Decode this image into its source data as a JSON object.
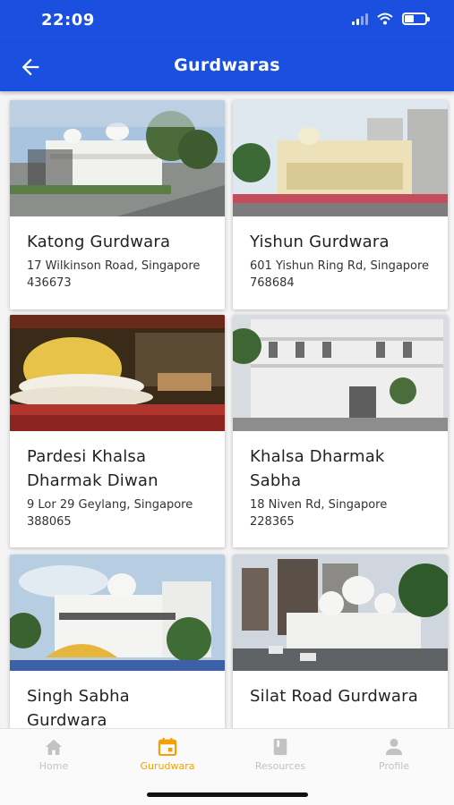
{
  "status_bar": {
    "time": "22:09"
  },
  "app_bar": {
    "title": "Gurdwaras"
  },
  "gurdwaras": [
    {
      "name": "Katong Gurdwara",
      "address": "17 Wilkinson Road, Singapore 436673"
    },
    {
      "name": "Yishun Gurdwara",
      "address": "601 Yishun Ring Rd, Singapore 768684"
    },
    {
      "name": "Pardesi Khalsa Dharmak Diwan",
      "address": "9 Lor 29 Geylang, Singapore 388065"
    },
    {
      "name": "Khalsa Dharmak Sabha",
      "address": "18 Niven Rd, Singapore 228365"
    },
    {
      "name": "Singh Sabha Gurdwara",
      "address": ""
    },
    {
      "name": "Silat Road Gurdwara",
      "address": ""
    }
  ],
  "bottom_nav": {
    "items": [
      {
        "label": "Home",
        "icon": "home-icon"
      },
      {
        "label": "Gurudwara",
        "icon": "calendar-icon",
        "active": true
      },
      {
        "label": "Resources",
        "icon": "book-icon"
      },
      {
        "label": "Profile",
        "icon": "person-icon"
      }
    ]
  },
  "colors": {
    "primary": "#1a4fe0",
    "active_tab": "#f3a100",
    "inactive_tab": "#c2c2c2"
  }
}
